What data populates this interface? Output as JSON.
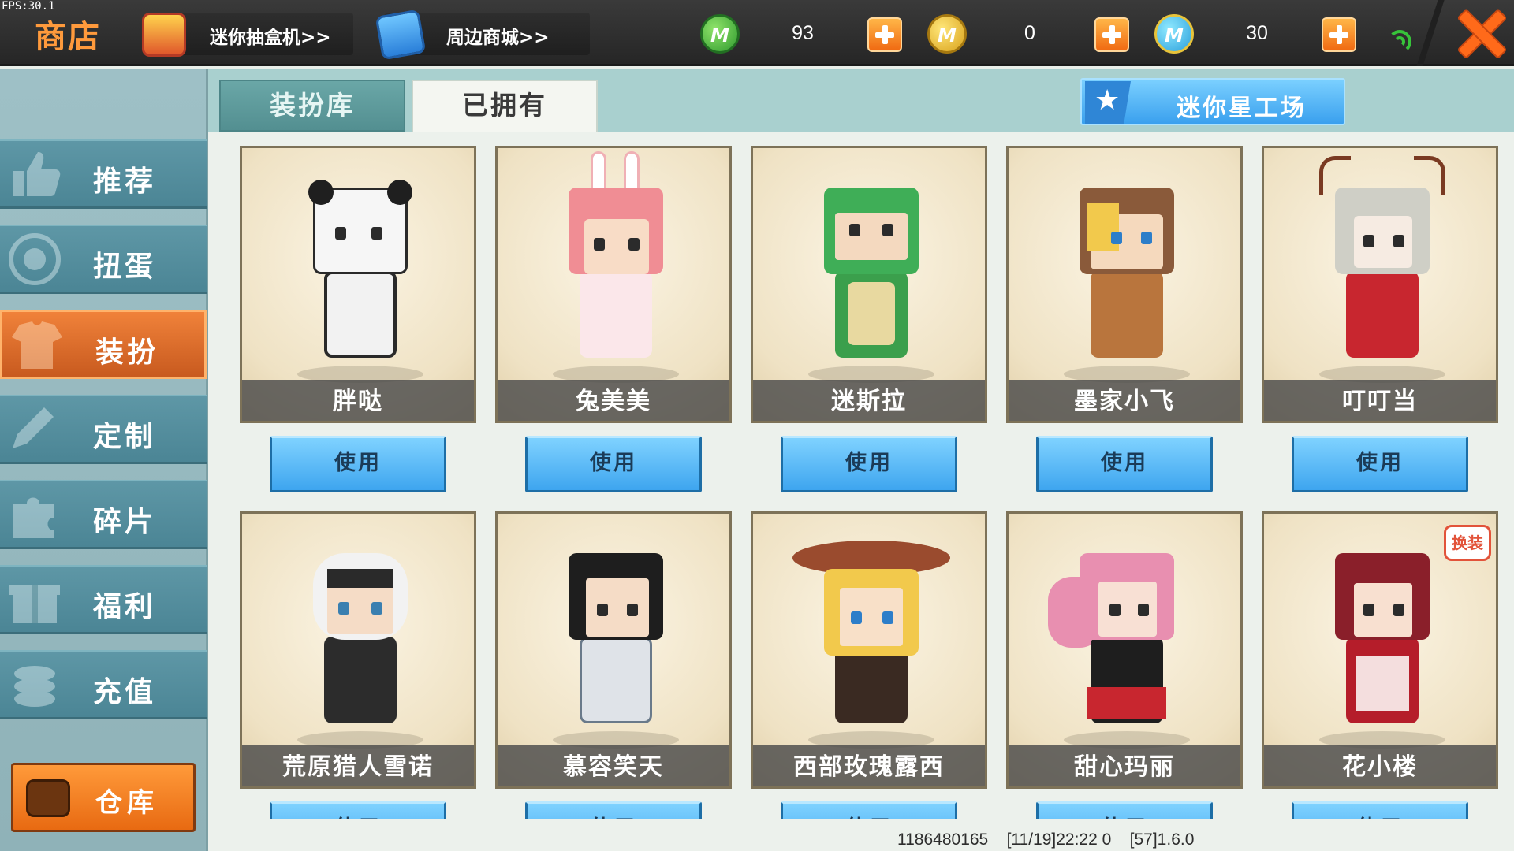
{
  "fps": "FPS:30.1",
  "header": {
    "title": "商店",
    "links": [
      {
        "label": "迷你抽盒机>>",
        "icon": "gift-box-icon"
      },
      {
        "label": "周边商城>>",
        "icon": "shopping-bag-icon"
      }
    ],
    "currencies": [
      {
        "icon": "green-coin-icon",
        "glyph": "M",
        "value": "93",
        "color": "#3aa83a"
      },
      {
        "icon": "gold-coin-icon",
        "glyph": "M",
        "value": "0",
        "color": "#e0b020"
      },
      {
        "icon": "blue-coin-icon",
        "glyph": "M",
        "value": "30",
        "color": "#2b9fdb"
      }
    ],
    "close_icon": "close-icon",
    "signal_icon": "wifi-signal-icon"
  },
  "sidebar": {
    "items": [
      {
        "label": "推荐",
        "icon": "thumbs-up-icon",
        "active": false
      },
      {
        "label": "扭蛋",
        "icon": "capsule-icon",
        "active": false
      },
      {
        "label": "装扮",
        "icon": "shirt-icon",
        "active": true
      },
      {
        "label": "定制",
        "icon": "pencil-icon",
        "active": false
      },
      {
        "label": "碎片",
        "icon": "puzzle-icon",
        "active": false
      },
      {
        "label": "福利",
        "icon": "gift-icon",
        "active": false
      },
      {
        "label": "充值",
        "icon": "coins-icon",
        "active": false
      }
    ],
    "warehouse_label": "仓库",
    "warehouse_icon": "chest-icon"
  },
  "tabs": [
    {
      "label": "装扮库",
      "active": false
    },
    {
      "label": "已拥有",
      "active": true
    }
  ],
  "workshop_label": "迷你星工场",
  "use_label": "使用",
  "characters": [
    {
      "name": "胖哒",
      "head": "#f6f6f6",
      "body": "#2a2a2a",
      "accent": "#1f1f1f"
    },
    {
      "name": "兔美美",
      "head": "#f08d94",
      "body": "#fbe7ea",
      "accent": "#ffffff"
    },
    {
      "name": "迷斯拉",
      "head": "#3fae57",
      "body": "#3b9f4c",
      "accent": "#e8d9a0"
    },
    {
      "name": "墨家小飞",
      "head": "#8a5a3a",
      "body": "#b9753d",
      "accent": "#f2c94c"
    },
    {
      "name": "叮叮当",
      "head": "#cfcfc6",
      "body": "#c8262f",
      "accent": "#7a3a22"
    },
    {
      "name": "荒原猎人雪诺",
      "head": "#f2f2f2",
      "body": "#2c2c2c",
      "accent": "#6d6a63"
    },
    {
      "name": "慕容笑天",
      "head": "#1e1e1e",
      "body": "#dfe3e8",
      "accent": "#6a7a8a"
    },
    {
      "name": "西部玫瑰露西",
      "head": "#9a4b2e",
      "body": "#3a2a22",
      "accent": "#f2c94c"
    },
    {
      "name": "甜心玛丽",
      "head": "#e88fb0",
      "body": "#1e1e1e",
      "accent": "#c8262f"
    },
    {
      "name": "花小楼",
      "head": "#8a1f2a",
      "body": "#b51d2a",
      "accent": "#f4dede",
      "badge": "换装"
    }
  ],
  "footer": {
    "uid": "1186480165",
    "time": "[11/19]22:22 0",
    "version": "[57]1.6.0"
  }
}
